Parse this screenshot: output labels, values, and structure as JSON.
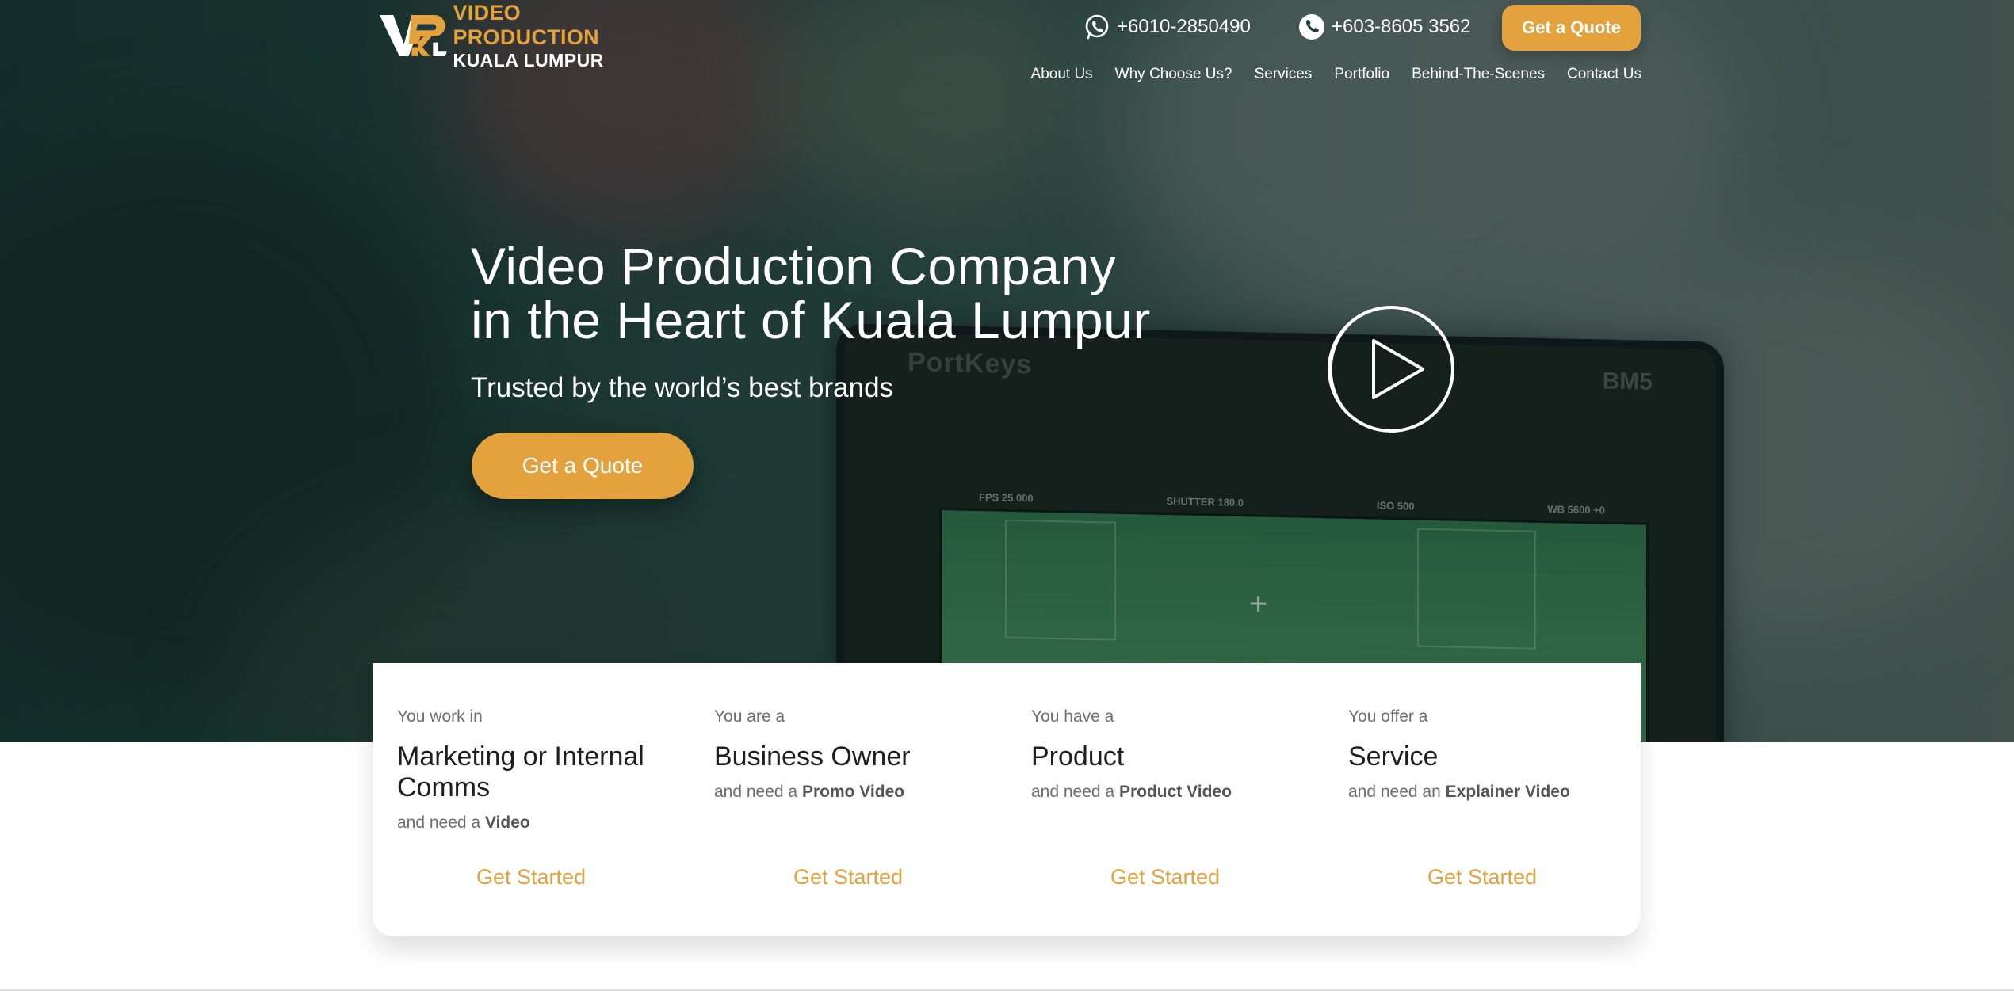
{
  "header": {
    "logo": {
      "line1": "VIDEO PRODUCTION",
      "line2": "KUALA LUMPUR",
      "mark_letters": "VPKL"
    },
    "whatsapp": "+6010-2850490",
    "phone": "+603-8605 3562",
    "quote_button": "Get a Quote",
    "nav": [
      "About Us",
      "Why Choose Us?",
      "Services",
      "Portfolio",
      "Behind-The-Scenes",
      "Contact Us"
    ]
  },
  "hero": {
    "title_line1": "Video Production Company",
    "title_line2": "in the Heart of Kuala Lumpur",
    "subtitle": "Trusted by the world’s best brands",
    "quote_button": "Get a Quote",
    "monitor_brand": "PortKeys",
    "monitor_model": "BM5",
    "monitor_hud": [
      "FPS 25.000",
      "SHUTTER 180.0",
      "ISO 500",
      "WB 5600 +0"
    ]
  },
  "audience": [
    {
      "pre": "You work in",
      "title": "Marketing or Internal Comms",
      "need_prefix": "and need a",
      "need_item": "Video",
      "cta": "Get Started"
    },
    {
      "pre": "You are a",
      "title": "Business Owner",
      "need_prefix": "and need a",
      "need_item": "Promo Video",
      "cta": "Get Started"
    },
    {
      "pre": "You have a",
      "title": "Product",
      "need_prefix": "and need a",
      "need_item": "Product Video",
      "cta": "Get Started"
    },
    {
      "pre": "You offer a",
      "title": "Service",
      "need_prefix": "and need an",
      "need_item": "Explainer Video",
      "cta": "Get Started"
    }
  ],
  "colors": {
    "accent": "#e3a23d",
    "hero_overlay": "#173430",
    "text_dark": "#1e1e1e"
  },
  "icons": [
    "whatsapp-icon",
    "phone-icon",
    "play-icon"
  ]
}
